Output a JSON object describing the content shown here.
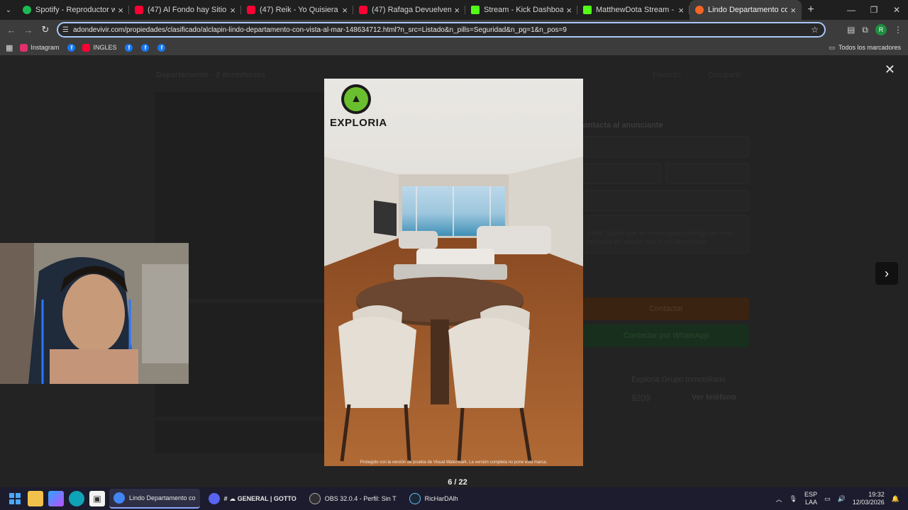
{
  "browser": {
    "tabs": [
      {
        "label": "Spotify - Reproductor web: mú",
        "color": "#1db954"
      },
      {
        "label": "(47) Al Fondo hay Sitio 8: Franc",
        "color": "#ff0033"
      },
      {
        "label": "(47) Reik - Yo Quisiera (Video)",
        "color": "#ff0033"
      },
      {
        "label": "(47) Rafaga Devuelveme la Vida",
        "color": "#ff0033"
      },
      {
        "label": "Stream - Kick Dashboard",
        "color": "#53fc18"
      },
      {
        "label": "MatthewDota Stream - Watch L",
        "color": "#53fc18"
      },
      {
        "label": "Lindo Departamento con Vista",
        "color": "#f26522"
      }
    ],
    "url": "adondevivir.com/propiedades/clasificado/alclapin-lindo-departamento-con-vista-al-mar-148634712.html?n_src=Listado&n_pills=Seguridad&n_pg=1&n_pos=9",
    "profile_initial": "R",
    "bookmarks": [
      {
        "label": "Instagram",
        "color": "#e1306c"
      },
      {
        "label": "INGLES",
        "color": "#ff0033"
      }
    ],
    "all_bookmarks_label": "Todos los marcadores"
  },
  "page": {
    "title": "Departamento · 3 dormitorios",
    "favorite_label": "Favorito",
    "share_label": "Compartir",
    "contact_heading": "ontacta al anunciante",
    "message_text": "¡Hola! Quiero que se comuniquen conmigo por este inmueble en alquiler que vi en Adondevivir.",
    "contact_button": "Contactar",
    "whatsapp_button": "Contactar por WhatsApp",
    "advertiser": "Exploria Grupo Inmobiliario",
    "phone_partial": "9209",
    "see_phone": "Ver teléfono"
  },
  "gallery": {
    "counter": "6 / 22",
    "brand": "EXPLORIA",
    "watermark": "Protegido con la versión de prueba de Visual Watermark. La versión completa no pone esta marca."
  },
  "taskbar": {
    "apps": [
      {
        "label": "Lindo Departamento co",
        "color": "#4285f4",
        "active": true
      },
      {
        "label": "# ☁ GENERAL | GOTTO",
        "color": "#5865f2",
        "active": false
      },
      {
        "label": "OBS 32.0.4 - Perfil: Sin T",
        "color": "#302e31",
        "active": false
      },
      {
        "label": "RicHarDAlh",
        "color": "#1b2838",
        "active": false
      }
    ],
    "lang_top": "ESP",
    "lang_bottom": "LAA",
    "time": "19:32",
    "date": "12/03/2026"
  }
}
